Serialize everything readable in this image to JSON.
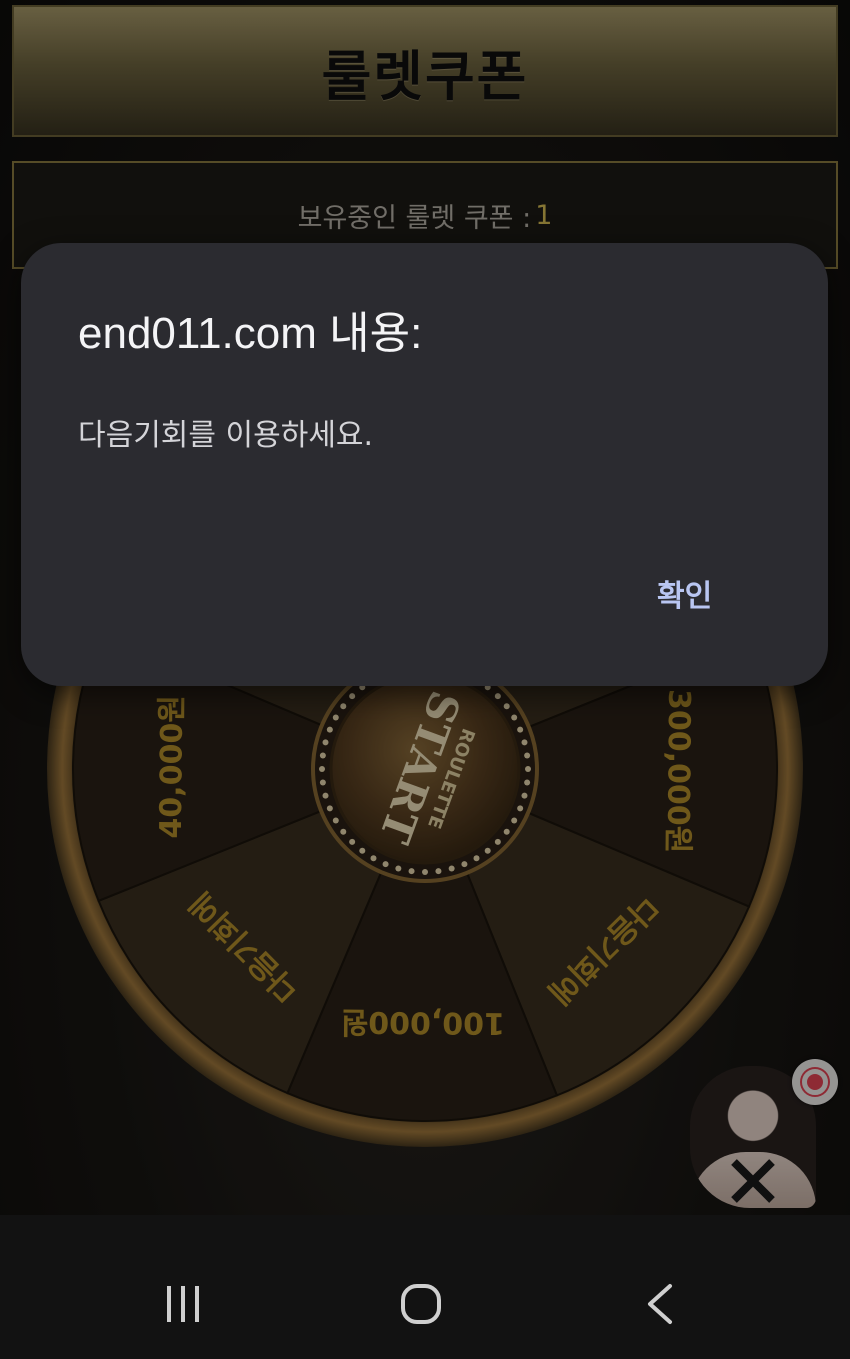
{
  "page": {
    "title": "룰렛쿠폰",
    "coupon_label": "보유중인 룰렛 쿠폰 :",
    "coupon_count": "1"
  },
  "wheel": {
    "center_top": "ROULETTE",
    "center_main": "START",
    "segments": [
      "다음기회에",
      "300,000원",
      "다음기회에",
      "100,000원",
      "다음기회에",
      "40,000원",
      "다음기회에"
    ],
    "colors": {
      "text": "#b48f2a",
      "rim": "#8a6a34",
      "panel_dark": "#2a2117",
      "panel_light": "#3a2f20"
    }
  },
  "dialog": {
    "title": "end011.com 내용:",
    "message": "다음기회를 이용하세요.",
    "ok_label": "확인"
  },
  "navbar": {
    "recent_icon": "recent-apps-icon",
    "home_icon": "home-icon",
    "back_icon": "back-icon"
  }
}
